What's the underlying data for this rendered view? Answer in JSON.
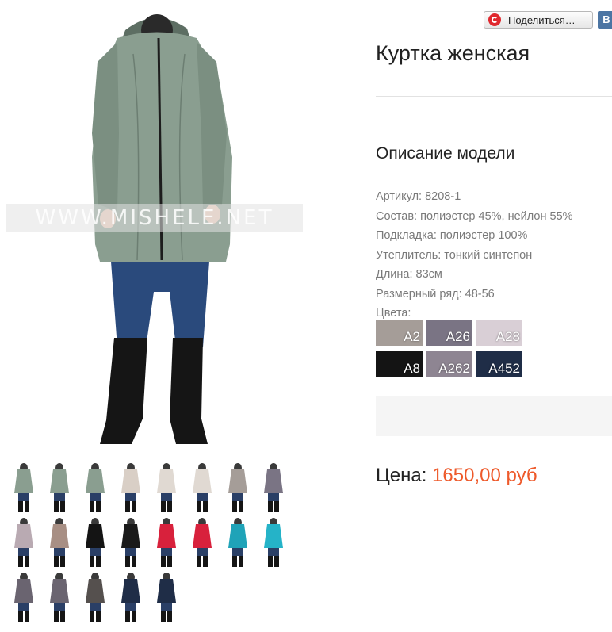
{
  "watermark": "WWW.MISHELE.NET",
  "share": {
    "label": "Поделиться…",
    "vk_label": "В"
  },
  "product": {
    "title": "Куртка женская"
  },
  "description": {
    "heading": "Описание модели",
    "specs": [
      "Артикул: 8208-1",
      "Состав: полиэстер 45%, нейлон 55%",
      "Подкладка: полиэстер 100%",
      "Утеплитель: тонкий синтепон",
      "Длина: 83см",
      "Размерный ряд: 48-56",
      "Цвета:"
    ]
  },
  "swatches": [
    {
      "code": "A2",
      "color": "#a59d98"
    },
    {
      "code": "A26",
      "color": "#7a7484"
    },
    {
      "code": "A28",
      "color": "#d9cfd6"
    },
    {
      "code": "A8",
      "color": "#141414"
    },
    {
      "code": "A262",
      "color": "#8e8592"
    },
    {
      "code": "A452",
      "color": "#1f2d47"
    }
  ],
  "price": {
    "label": "Цена:",
    "value": "1650,00 руб"
  },
  "thumbnails": [
    "#8a9e90",
    "#8a9e90",
    "#8a9e90",
    "#d9cfc6",
    "#e0d9d2",
    "#e0d9d2",
    "#a59d98",
    "#7a7484",
    "#b9aab2",
    "#a88f84",
    "#141414",
    "#1a1a1a",
    "#d8213c",
    "#d8213c",
    "#1fa3b8",
    "#25b3c8",
    "#6a6470",
    "#6a6470",
    "#55504e",
    "#1f2d47",
    "#1f2d47"
  ]
}
